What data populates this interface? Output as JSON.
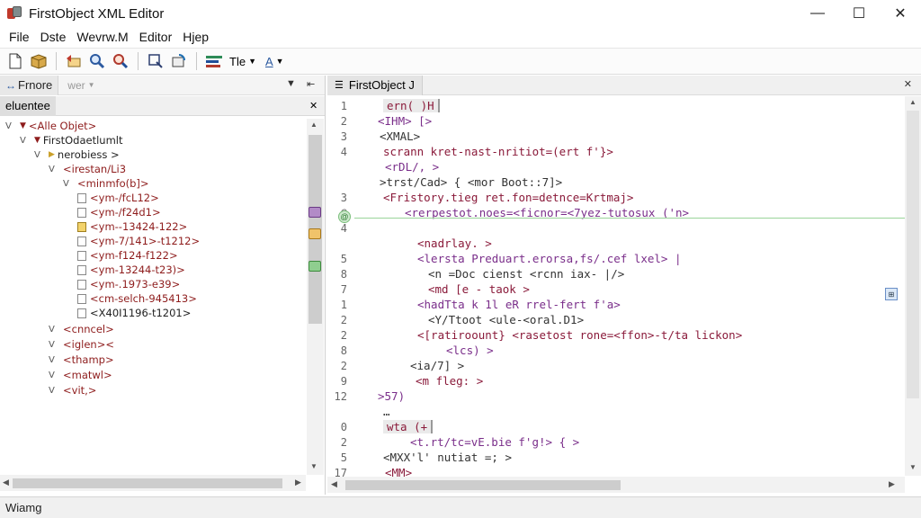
{
  "window": {
    "title": "FirstObject XML Editor",
    "controls": [
      "—",
      "☐",
      "✕"
    ]
  },
  "menu": [
    "File",
    "Dste",
    "Wevrw.M",
    "Editor",
    "Hjep"
  ],
  "toolbar": {
    "buttons": [
      "new-file-icon",
      "open-box-icon",
      "undo-icon",
      "zoom-in-icon",
      "find-icon",
      "select-icon",
      "refresh-icon",
      "format-icon"
    ],
    "file_dropdown": "Tle",
    "style_dropdown": "A"
  },
  "left_pane": {
    "tab_label": "Frnore",
    "tab2_label": "wer",
    "subheader": "eluentee",
    "tree": [
      {
        "w": "V",
        "arrow": "▼",
        "text": "<Alle Objet>",
        "kind": "tag"
      },
      {
        "w": "V",
        "arrow": "▼",
        "text": "FirstOdaetlumlt",
        "kind": "plain"
      },
      {
        "w": "V",
        "arrow": "▶",
        "text": "nerobiess >",
        "kind": "plain",
        "y": true
      },
      {
        "w": "V",
        "text": "<irestan/Li3",
        "kind": "tag"
      },
      {
        "w": "V",
        "text": "<minmfo(b]>",
        "kind": "tag"
      },
      {
        "box": true,
        "text": "<ym-/fcL12>",
        "kind": "tag"
      },
      {
        "box": true,
        "text": "<ym-/f24d1>",
        "kind": "tag"
      },
      {
        "box": true,
        "y": true,
        "text": "<ym--13424-122>",
        "kind": "tag"
      },
      {
        "box": true,
        "text": "<ym-7/141>-t1212>",
        "kind": "tag"
      },
      {
        "box": true,
        "text": "<ym-f124-f122>",
        "kind": "tag"
      },
      {
        "box": true,
        "text": "<ym-13244-t23)>",
        "kind": "tag"
      },
      {
        "box": true,
        "text": "<ym-.1973-e39>",
        "kind": "tag"
      },
      {
        "box": true,
        "text": "<cm-selch-945413>",
        "kind": "tag"
      },
      {
        "box": true,
        "text": "<X40I1196-t1201>",
        "kind": "plain"
      },
      {
        "w": "V",
        "text": "<cnncel>",
        "kind": "tag"
      },
      {
        "w": "V",
        "text": "<iglen><",
        "kind": "tag"
      },
      {
        "w": "V",
        "text": "<thamp>",
        "kind": "tag"
      },
      {
        "w": "V",
        "text": "<matwl>",
        "kind": "tag"
      },
      {
        "w": "V",
        "text": "<vit,>",
        "kind": "tag"
      }
    ]
  },
  "editor": {
    "tab_label": "FirstObject J",
    "lines": [
      {
        "n": "1",
        "text": "ern( )H",
        "box": true
      },
      {
        "n": "2",
        "text": "<IHM>  [>"
      },
      {
        "n": "3",
        "text": "<XMAL>"
      },
      {
        "n": "4",
        "text": "scrann kret-nast-nritiot=(ert f'}>"
      },
      {
        "n": "",
        "text": "<rDL/, >"
      },
      {
        "n": "",
        "text": ">trst/Cad> {  <mor Boot::7]>"
      },
      {
        "n": "3",
        "text": "<Fristory.tieg ret.fon=detnce=Krtmaj>"
      },
      {
        "n": "@",
        "text": "<rerpestot.noes=<ficnor=<7yez-tutosux ('n>"
      },
      {
        "n": "4",
        "text": ""
      },
      {
        "n": "",
        "text": "<nadrlay.  >"
      },
      {
        "n": "5",
        "text": "<lersta Preduart.erorsa,fs/.cef lxel>  |"
      },
      {
        "n": "8",
        "text": "<n =Doc cienst <rcnn iax-  |/>"
      },
      {
        "n": "7",
        "text": "<md [e  -  taok >"
      },
      {
        "n": "1",
        "text": "<hadTta  k 1l  eR rrel-fert f'a>"
      },
      {
        "n": "2",
        "text": "<Y/Ttoot <ule-<oral.D1>"
      },
      {
        "n": "2",
        "text": "<[ratiroount} <rasetost rone=<ffon>-t/ta lickon>"
      },
      {
        "n": "8",
        "text": "<lcs) >"
      },
      {
        "n": "2",
        "text": "<ia/7]           >"
      },
      {
        "n": "9",
        "text": "<m  fleg:  >"
      },
      {
        "n": "12",
        "text": ">57)"
      },
      {
        "n": "",
        "text": "…"
      },
      {
        "n": "0",
        "text": "wta (+",
        "box": true
      },
      {
        "n": "2",
        "text": "<t.rt/tc=vE.bie f'g!>   {   >"
      },
      {
        "n": "5",
        "text": "<MXX'l' nutiat =;        >"
      },
      {
        "n": "17",
        "text": "<MM>"
      }
    ]
  },
  "status": "Wiamg",
  "colors": {
    "tag": "#8a1a3a",
    "attr": "#7a2e8a",
    "value": "#1b5fae",
    "active_line": "#9ad49a"
  }
}
